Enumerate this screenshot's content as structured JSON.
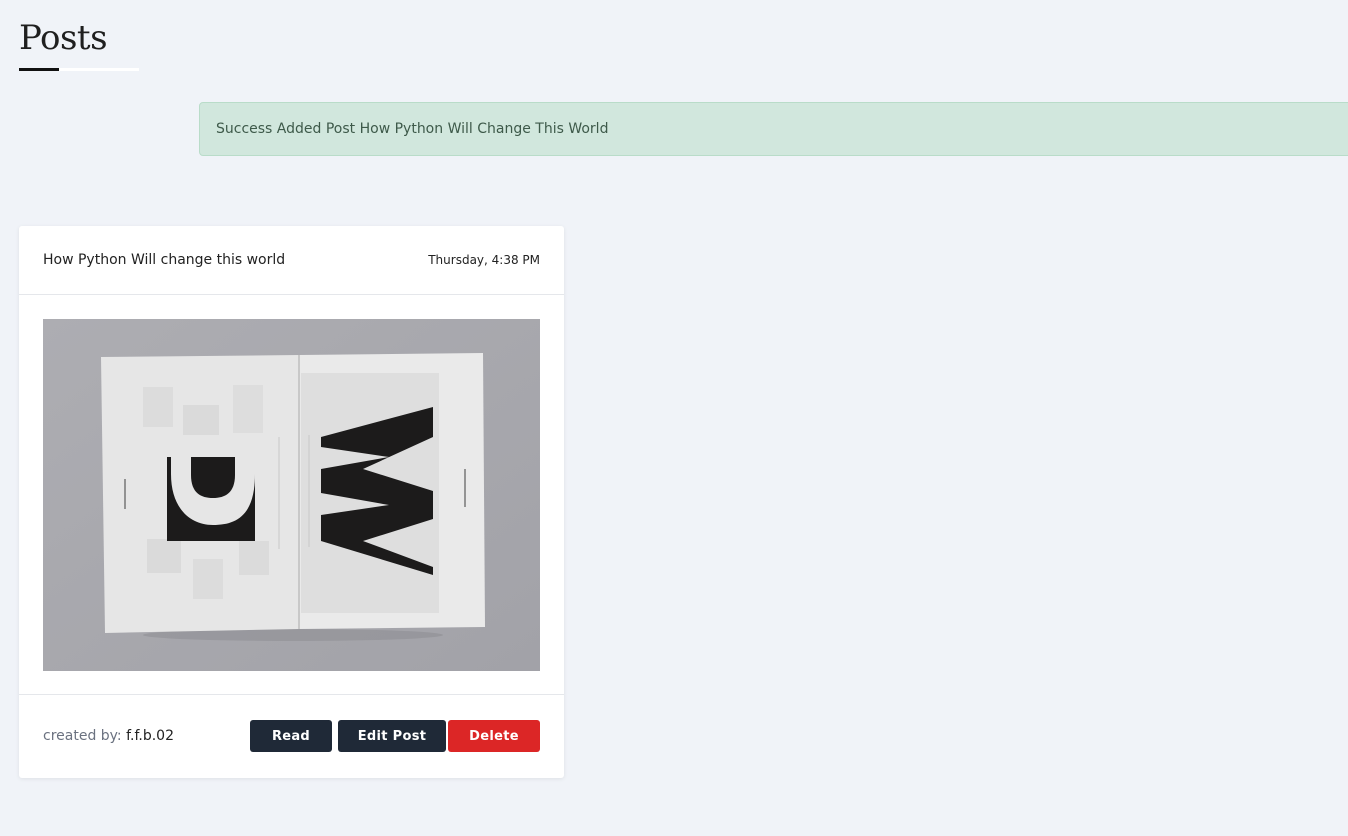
{
  "page": {
    "title": "Posts"
  },
  "alert": {
    "message": "Success Added Post How Python Will Change This World"
  },
  "post": {
    "title": "How Python Will change this world",
    "time": "Thursday, 4:38 PM",
    "image_alt": "Open magazine with large P and W letters",
    "created_by_label": "created by:",
    "author": "f.f.b.02"
  },
  "actions": {
    "read_label": "Read",
    "edit_label": "Edit Post",
    "delete_label": "Delete"
  },
  "colors": {
    "background": "#f0f3f8",
    "alert_bg": "#d1e7dd",
    "dark_button": "#1f2937",
    "danger_button": "#dc2626"
  }
}
